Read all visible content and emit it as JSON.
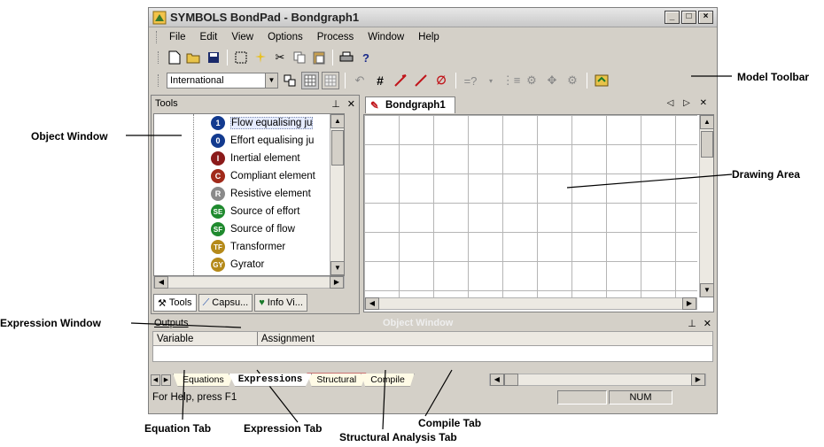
{
  "window": {
    "title": "SYMBOLS BondPad - Bondgraph1",
    "controls": [
      "_",
      "□",
      "×"
    ]
  },
  "menubar": {
    "items": [
      "File",
      "Edit",
      "View",
      "Options",
      "Process",
      "Window",
      "Help"
    ]
  },
  "model_toolbar": {
    "language_value": "International"
  },
  "tools_panel": {
    "title": "Tools",
    "items": [
      {
        "label": "Flow equalising ju",
        "badge": "1",
        "color": "#123a8f"
      },
      {
        "label": "Effort equalising ju",
        "badge": "0",
        "color": "#123a8f"
      },
      {
        "label": "Inertial element",
        "badge": "I",
        "color": "#8b1a1a"
      },
      {
        "label": "Compliant element",
        "badge": "C",
        "color": "#a12a1a"
      },
      {
        "label": "Resistive element",
        "badge": "R",
        "color": "#8a8a8a"
      },
      {
        "label": "Source of effort",
        "badge": "SE",
        "color": "#1f8a2e"
      },
      {
        "label": "Source of flow",
        "badge": "SF",
        "color": "#1f8a2e"
      },
      {
        "label": "Transformer",
        "badge": "TF",
        "color": "#b58a1a"
      },
      {
        "label": "Gyrator",
        "badge": "GY",
        "color": "#b58a1a"
      }
    ],
    "tabs": [
      "Tools",
      "Capsu...",
      "Info Vi..."
    ]
  },
  "document": {
    "tab_label": "Bondgraph1"
  },
  "outputs": {
    "title": "Outputs",
    "watermark": "Object Window",
    "columns": [
      "Variable",
      "Assignment"
    ],
    "tabs": [
      "Equations",
      "Expressions",
      "Structural",
      "Compile"
    ],
    "active_tab": "Expressions"
  },
  "statusbar": {
    "help_text": "For Help, press F1",
    "num_indicator": "NUM"
  },
  "annotations": {
    "model_toolbar": "Model Toolbar",
    "object_window": "Object Window",
    "drawing_area": "Drawing Area",
    "expression_window": "Expression Window",
    "equation_tab": "Equation Tab",
    "expression_tab": "Expression Tab",
    "structural_tab": "Structural Analysis Tab",
    "compile_tab": "Compile Tab"
  },
  "colors": {
    "window_bg": "#d4d0c8",
    "red_arrow": "#c0151b",
    "tab_outline_red": "#c0151b"
  }
}
